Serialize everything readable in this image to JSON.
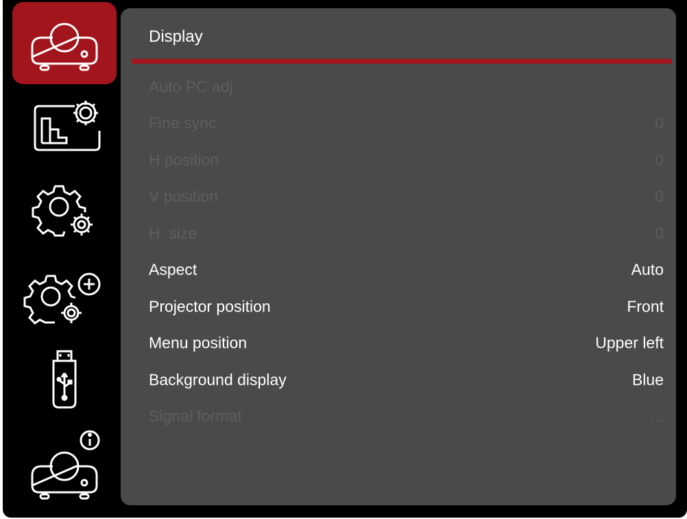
{
  "colors": {
    "accent": "#a3151c",
    "panel": "#4a4a4a",
    "enabled_text": "#ffffff",
    "disabled_text": "#5e5e5e"
  },
  "sidebar": {
    "items": [
      {
        "name": "projector-icon",
        "active": true
      },
      {
        "name": "picture-settings-icon",
        "active": false
      },
      {
        "name": "settings-gears-icon",
        "active": false
      },
      {
        "name": "advanced-settings-icon",
        "active": false
      },
      {
        "name": "usb-icon",
        "active": false
      },
      {
        "name": "projector-info-icon",
        "active": false
      }
    ]
  },
  "panel": {
    "title": "Display",
    "rows": [
      {
        "label": "Auto PC adj.",
        "value": "",
        "enabled": false
      },
      {
        "label": "Fine sync",
        "value": "0",
        "enabled": false
      },
      {
        "label": "H position",
        "value": "0",
        "enabled": false
      },
      {
        "label": "V position",
        "value": "0",
        "enabled": false
      },
      {
        "label": "H. size",
        "value": "0",
        "enabled": false
      },
      {
        "label": "Aspect",
        "value": "Auto",
        "enabled": true
      },
      {
        "label": "Projector position",
        "value": "Front",
        "enabled": true
      },
      {
        "label": "Menu position",
        "value": "Upper left",
        "enabled": true
      },
      {
        "label": "Background display",
        "value": "Blue",
        "enabled": true
      },
      {
        "label": "Signal format",
        "value": "...",
        "enabled": false
      }
    ]
  }
}
